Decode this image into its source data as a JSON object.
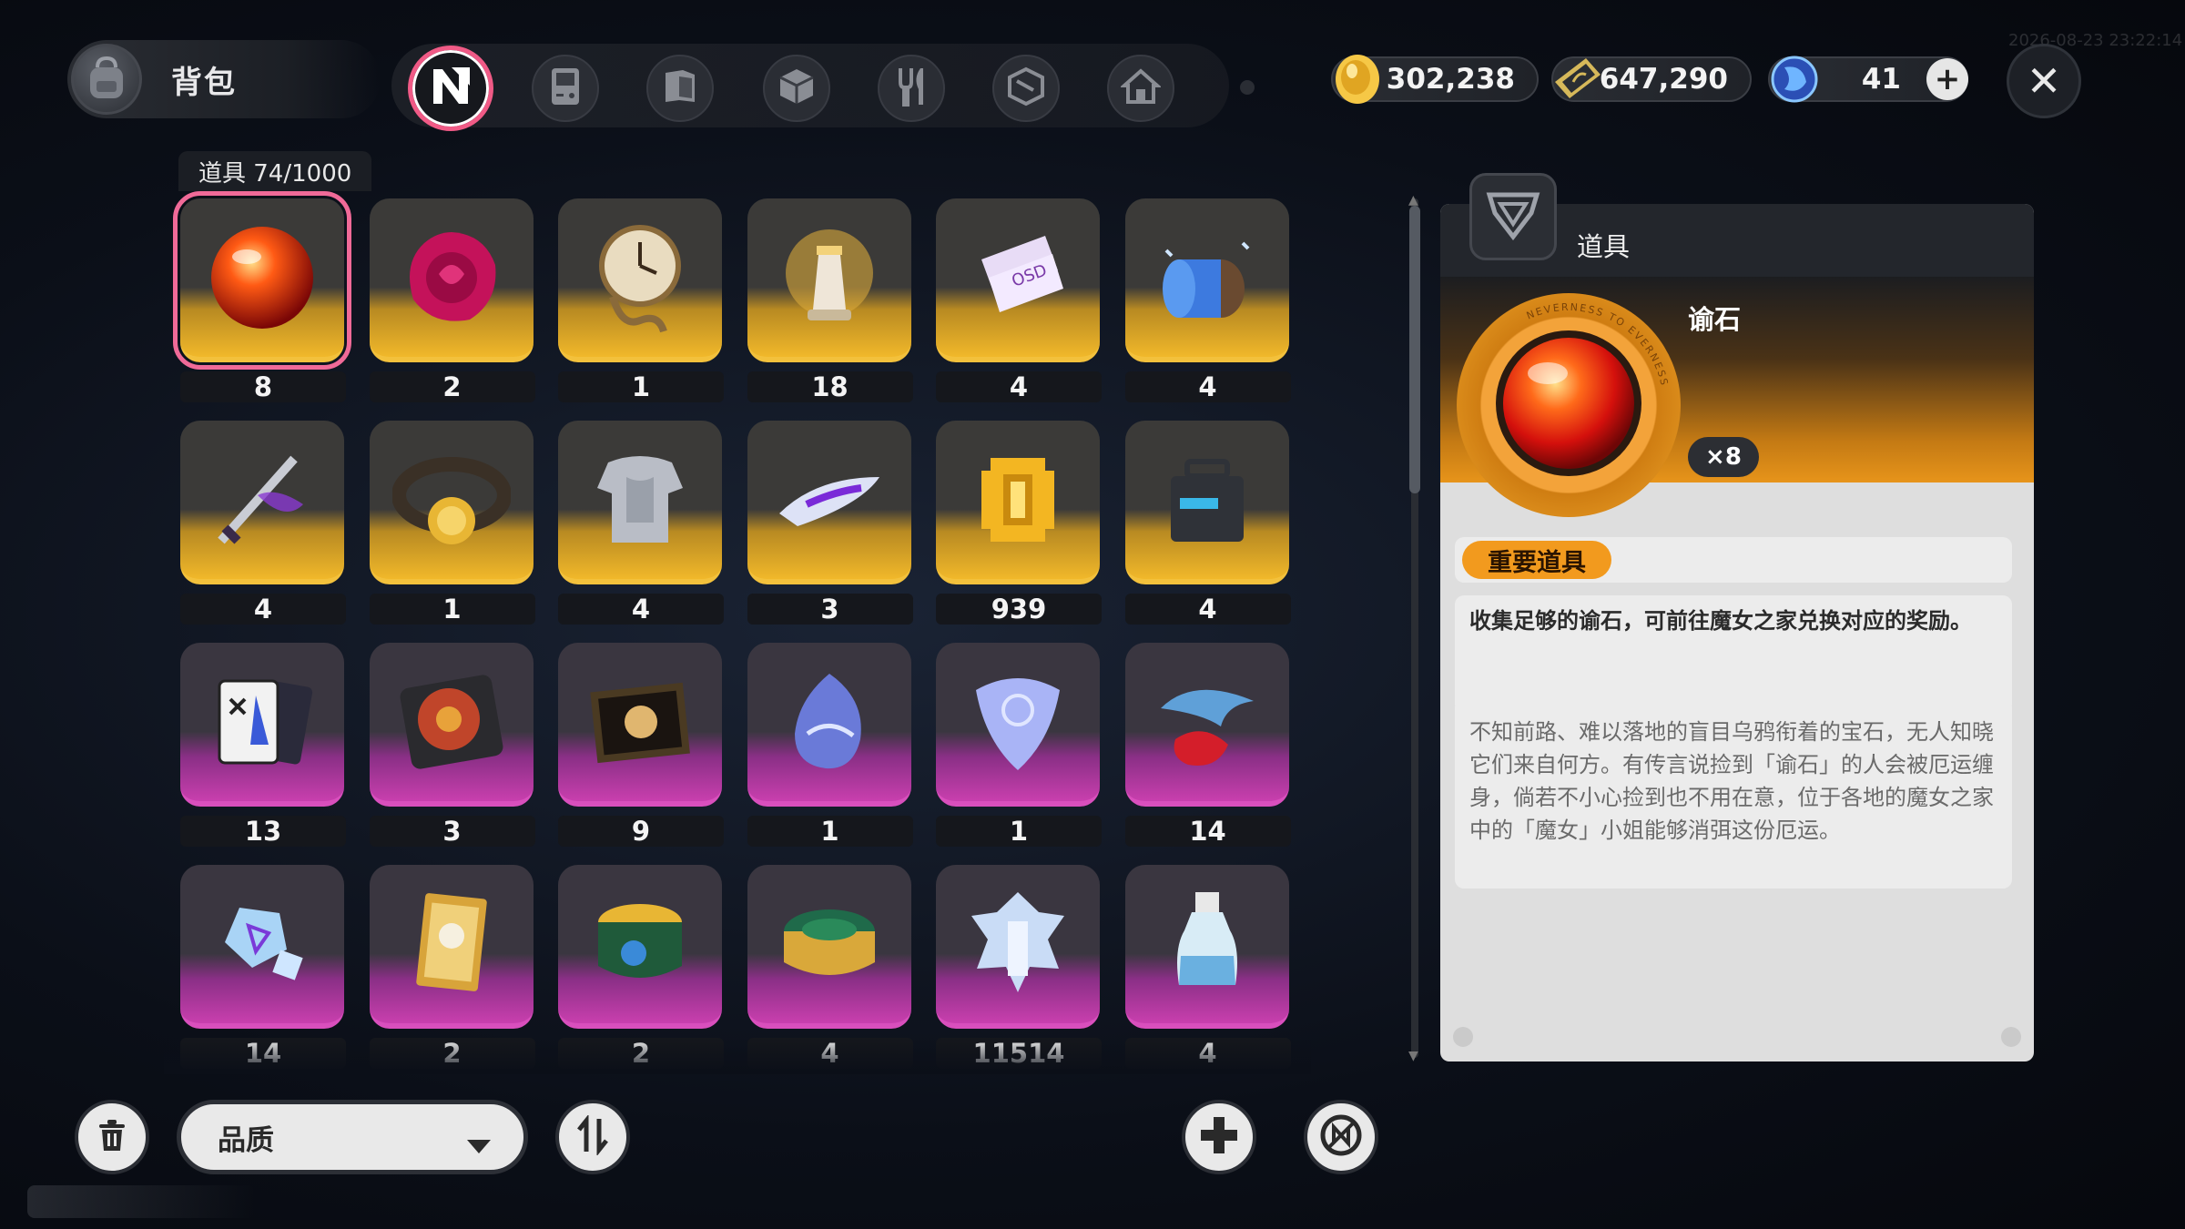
{
  "header": {
    "bag_title": "背包",
    "tabs": [
      {
        "icon": "n-logo-icon",
        "active": true
      },
      {
        "icon": "gameboy-icon",
        "active": false
      },
      {
        "icon": "book-icon",
        "active": false
      },
      {
        "icon": "cube-icon",
        "active": false
      },
      {
        "icon": "fork-knife-icon",
        "active": false
      },
      {
        "icon": "package-icon",
        "active": false
      },
      {
        "icon": "house-icon",
        "active": false
      }
    ],
    "currencies": [
      {
        "icon": "gold-coin-icon",
        "value": "302,238"
      },
      {
        "icon": "ticket-icon",
        "value": "647,290"
      },
      {
        "icon": "crystal-icon",
        "value": "41"
      }
    ],
    "timestamp": "2026-08-23 23:22:14"
  },
  "category": {
    "label": "道具 74/1000"
  },
  "items": [
    {
      "icon": "fire-orb-icon",
      "count": "8",
      "rarity": "gold",
      "selected": true
    },
    {
      "icon": "wax-seal-icon",
      "count": "2",
      "rarity": "gold"
    },
    {
      "icon": "melting-clock-icon",
      "count": "1",
      "rarity": "gold"
    },
    {
      "icon": "chess-trophy-icon",
      "count": "18",
      "rarity": "gold"
    },
    {
      "icon": "tickets-icon",
      "count": "4",
      "rarity": "gold"
    },
    {
      "icon": "thread-spool-icon",
      "count": "4",
      "rarity": "gold"
    },
    {
      "icon": "dark-sword-icon",
      "count": "4",
      "rarity": "gold"
    },
    {
      "icon": "champion-belt-icon",
      "count": "1",
      "rarity": "gold"
    },
    {
      "icon": "armor-icon",
      "count": "4",
      "rarity": "gold"
    },
    {
      "icon": "hover-board-icon",
      "count": "3",
      "rarity": "gold"
    },
    {
      "icon": "pixel-coin-icon",
      "count": "939",
      "rarity": "gold"
    },
    {
      "icon": "supply-box-icon",
      "count": "4",
      "rarity": "gold"
    },
    {
      "icon": "card-deck-icon",
      "count": "13",
      "rarity": "purple"
    },
    {
      "icon": "vinyl-player-icon",
      "count": "3",
      "rarity": "purple"
    },
    {
      "icon": "painting-icon",
      "count": "9",
      "rarity": "purple"
    },
    {
      "icon": "spirit-egg-icon",
      "count": "1",
      "rarity": "purple"
    },
    {
      "icon": "guitar-pick-icon",
      "count": "1",
      "rarity": "purple"
    },
    {
      "icon": "dolphin-icon",
      "count": "14",
      "rarity": "purple"
    },
    {
      "icon": "crystal-cluster-icon",
      "count": "14",
      "rarity": "purple"
    },
    {
      "icon": "rose-card-icon",
      "count": "2",
      "rarity": "purple"
    },
    {
      "icon": "coin-drum-icon",
      "count": "2",
      "rarity": "purple"
    },
    {
      "icon": "jewel-box-icon",
      "count": "4",
      "rarity": "purple"
    },
    {
      "icon": "ice-chess-icon",
      "count": "11514",
      "rarity": "purple"
    },
    {
      "icon": "potion-bottle-icon",
      "count": "4",
      "rarity": "purple"
    }
  ],
  "detail": {
    "header_title": "道具",
    "name": "谕石",
    "quantity": "×8",
    "ring_text": "NEVERNESS TO EVERNESS",
    "tag": "重要道具",
    "description": "收集足够的谕石，可前往魔女之家兑换对应的奖励。",
    "lore": "不知前路、难以落地的盲目乌鸦衔着的宝石，无人知晓它们来自何方。有传言说捡到「谕石」的人会被厄运缠身，倘若不小心捡到也不用在意，位于各地的魔女之家中的「魔女」小姐能够消弭这份厄运。"
  },
  "footer": {
    "filter_label": "品质"
  },
  "colors": {
    "gold": "#f1b82a",
    "purple": "#c93fae",
    "accent_pink": "#f05a86",
    "tag_orange": "#f29a1e"
  }
}
